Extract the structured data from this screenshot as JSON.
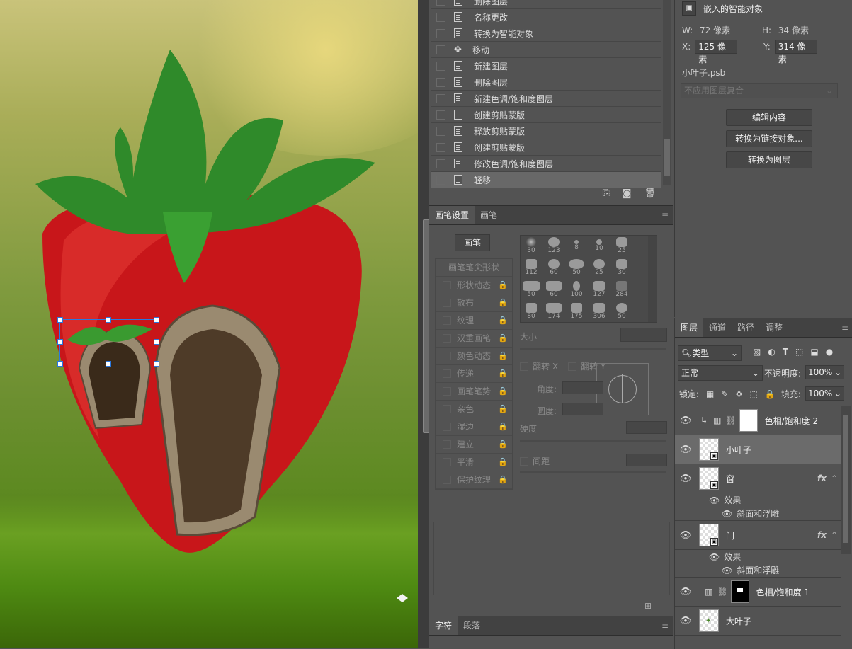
{
  "history": {
    "items": [
      {
        "label": "删除图层",
        "icon": "document-icon"
      },
      {
        "label": "名称更改",
        "icon": "document-icon"
      },
      {
        "label": "转换为智能对象",
        "icon": "document-icon"
      },
      {
        "label": "移动",
        "icon": "move-icon"
      },
      {
        "label": "新建图层",
        "icon": "document-icon"
      },
      {
        "label": "删除图层",
        "icon": "document-icon"
      },
      {
        "label": "新建色调/饱和度图层",
        "icon": "document-icon"
      },
      {
        "label": "创建剪贴蒙版",
        "icon": "document-icon"
      },
      {
        "label": "释放剪贴蒙版",
        "icon": "document-icon"
      },
      {
        "label": "创建剪贴蒙版",
        "icon": "document-icon"
      },
      {
        "label": "修改色调/饱和度图层",
        "icon": "document-icon"
      },
      {
        "label": "轻移",
        "icon": "document-icon",
        "selected": true
      }
    ]
  },
  "properties": {
    "title": "嵌入的智能对象",
    "w_label": "W:",
    "w_value": "72 像素",
    "h_label": "H:",
    "h_value": "34 像素",
    "x_label": "X:",
    "x_value": "125 像素",
    "y_label": "Y:",
    "y_value": "314 像素",
    "filename": "小叶子.psb",
    "comp_select": "不应用图层复合",
    "btn_edit": "编辑内容",
    "btn_link": "转换为链接对象...",
    "btn_layer": "转换为图层"
  },
  "brush": {
    "tabs": [
      "画笔设置",
      "画笔"
    ],
    "brush_button": "画笔",
    "tip_shape": "画笔笔尖形状",
    "options": [
      "形状动态",
      "散布",
      "纹理",
      "双重画笔",
      "颜色动态",
      "传递",
      "画笔笔势",
      "杂色",
      "湿边",
      "建立",
      "平滑",
      "保护纹理"
    ],
    "sizes": [
      "30",
      "123",
      "8",
      "10",
      "25",
      "112",
      "60",
      "50",
      "25",
      "30",
      "50",
      "60",
      "100",
      "127",
      "284",
      "80",
      "174",
      "175",
      "306",
      "50"
    ],
    "size_label": "大小",
    "flip_x": "翻转 X",
    "flip_y": "翻转 Y",
    "angle_label": "角度:",
    "roundness_label": "圆度:",
    "hardness_label": "硬度",
    "spacing_label": "间距"
  },
  "char": {
    "tabs": [
      "字符",
      "段落"
    ]
  },
  "layers": {
    "tabs": [
      "图层",
      "通道",
      "路径",
      "调整"
    ],
    "filter_kind": "类型",
    "blend_mode": "正常",
    "opacity_label": "不透明度:",
    "opacity_value": "100%",
    "lock_label": "锁定:",
    "fill_label": "填充:",
    "fill_value": "100%",
    "items": [
      {
        "name": "色相/饱和度 2"
      },
      {
        "name": "小叶子"
      },
      {
        "name": "窗",
        "fx": "fx",
        "effects_label": "效果",
        "effect": "斜面和浮雕"
      },
      {
        "name": "门",
        "fx": "fx",
        "effects_label": "效果",
        "effect": "斜面和浮雕"
      },
      {
        "name": "色相/饱和度 1"
      },
      {
        "name": "大叶子"
      }
    ]
  }
}
